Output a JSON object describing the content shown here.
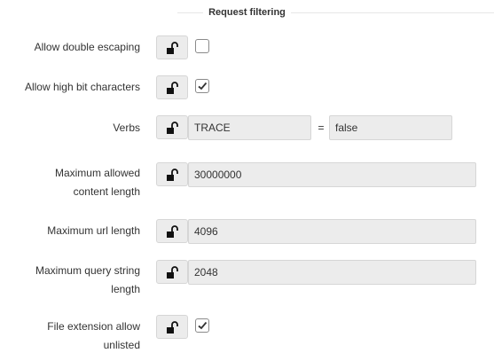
{
  "section": {
    "title": "Request filtering"
  },
  "rows": {
    "double_escaping": {
      "label": "Allow double escaping",
      "checked": false
    },
    "high_bit": {
      "label": "Allow high bit characters",
      "checked": true
    },
    "verbs": {
      "label": "Verbs",
      "verb": "TRACE",
      "equals": "=",
      "allowed": "false"
    },
    "max_content": {
      "label_line1": "Maximum allowed",
      "label_line2": "content length",
      "value": "30000000"
    },
    "max_url": {
      "label": "Maximum url length",
      "value": "4096"
    },
    "max_query": {
      "label_line1": "Maximum query string",
      "label_line2": "length",
      "value": "2048"
    },
    "file_ext": {
      "label_line1": "File extension allow",
      "label_line2": "unlisted",
      "checked": true
    }
  },
  "icons": {
    "lock": "unlocked-padlock-icon",
    "check": "checkmark-icon"
  }
}
